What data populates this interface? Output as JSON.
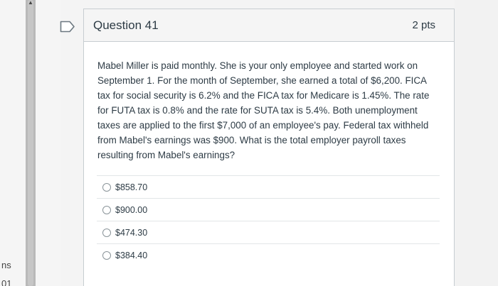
{
  "question": {
    "title": "Question 41",
    "points": "2 pts",
    "text": "Mabel Miller is paid monthly. She is your only employee and started work on September 1. For the month of September, she earned a total of $6,200. FICA tax for social security is 6.2% and the FICA tax for Medicare is 1.45%. The rate for FUTA tax is 0.8% and the rate for SUTA tax is 5.4%. Both unemployment taxes are applied to the first $7,000 of an employee's pay. Federal tax withheld from Mabel's earnings was $900. What is the total employer payroll taxes resulting from Mabel's earnings?",
    "answers": [
      {
        "label": "$858.70",
        "selected": false
      },
      {
        "label": "$900.00",
        "selected": false
      },
      {
        "label": "$474.30",
        "selected": false
      },
      {
        "label": "$384.40",
        "selected": false
      }
    ]
  },
  "left_fragments": {
    "line1": "ns",
    "line2": "01"
  },
  "icons": {
    "flag": "flag-icon",
    "radio": "radio-icon",
    "scroll_up": "scroll-up-icon"
  },
  "colors": {
    "header_bg": "#f5f5f5",
    "text": "#2d3b45",
    "border": "#c7cdd1"
  }
}
